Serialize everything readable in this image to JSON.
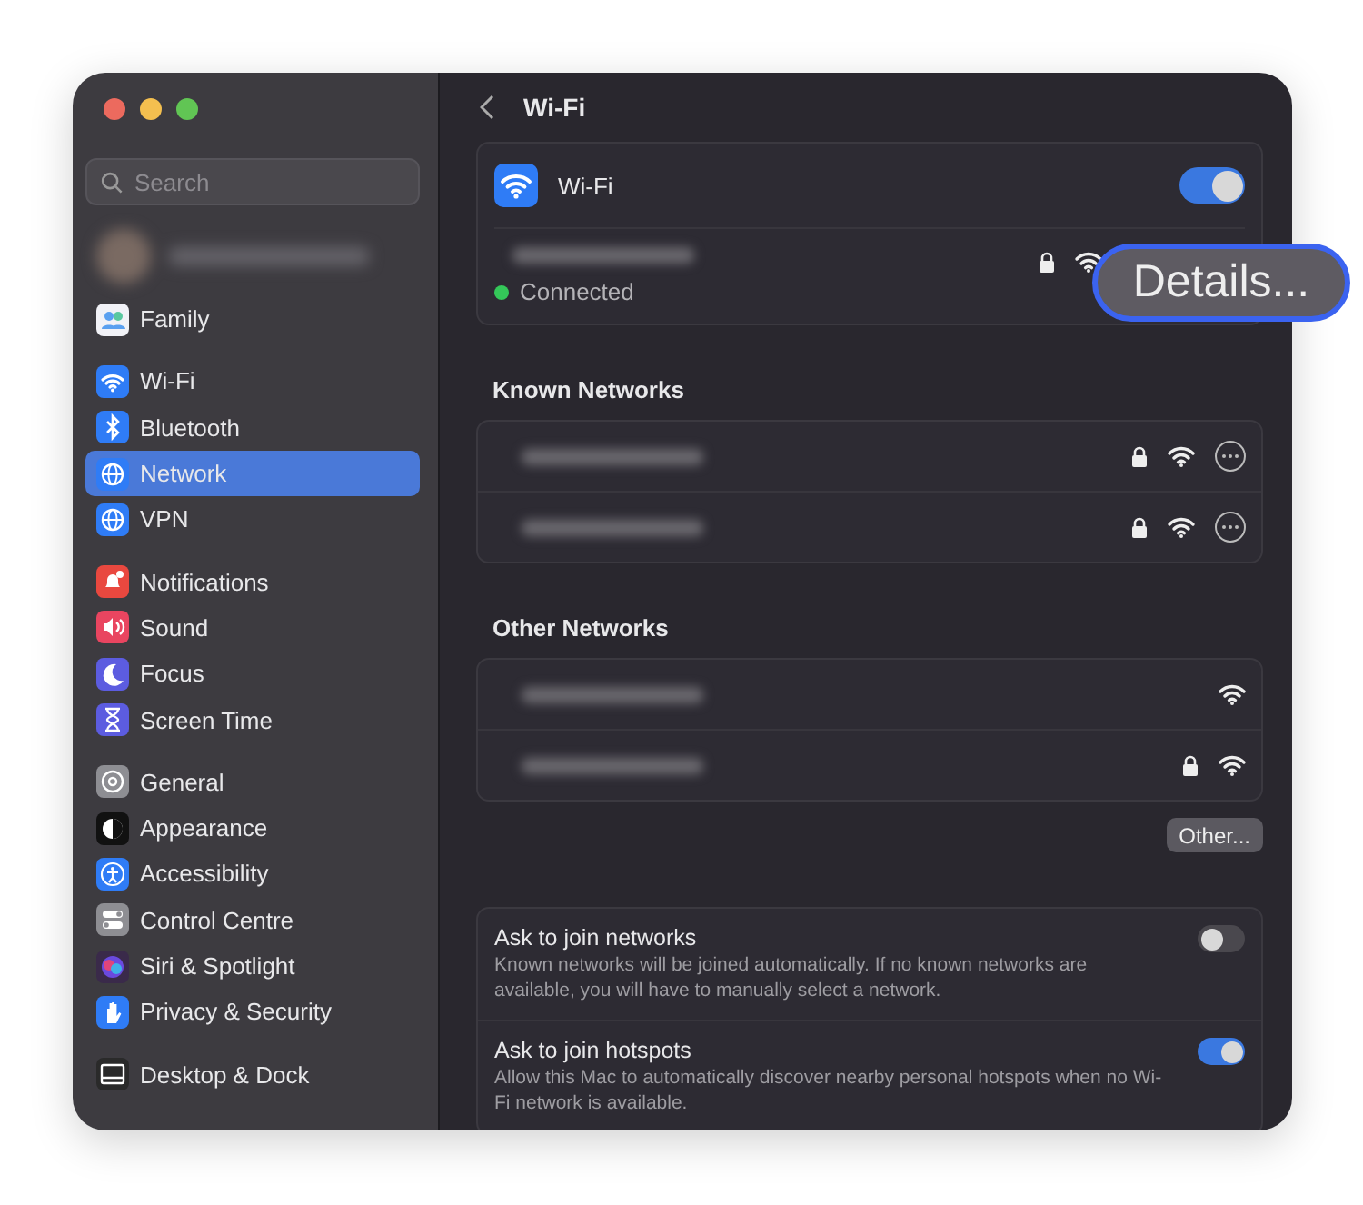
{
  "sidebar": {
    "search": {
      "placeholder": "Search"
    },
    "groups": [
      [
        {
          "label": "Family",
          "kind": "family",
          "color": "#f2f2f7",
          "selected": false
        }
      ],
      [
        {
          "label": "Wi-Fi",
          "kind": "wifi",
          "color": "#2f7cf6",
          "selected": false
        },
        {
          "label": "Bluetooth",
          "kind": "bluetooth",
          "color": "#2f7cf6",
          "selected": false
        },
        {
          "label": "Network",
          "kind": "globe",
          "color": "#2f7cf6",
          "selected": true
        },
        {
          "label": "VPN",
          "kind": "globe",
          "color": "#2f7cf6",
          "selected": false
        }
      ],
      [
        {
          "label": "Notifications",
          "kind": "bell",
          "color": "#e9483f",
          "selected": false
        },
        {
          "label": "Sound",
          "kind": "speaker",
          "color": "#e94560",
          "selected": false
        },
        {
          "label": "Focus",
          "kind": "moon",
          "color": "#5c5ce0",
          "selected": false
        },
        {
          "label": "Screen Time",
          "kind": "hourglass",
          "color": "#5c5ce0",
          "selected": false
        }
      ],
      [
        {
          "label": "General",
          "kind": "gear",
          "color": "#8e8e93",
          "selected": false
        },
        {
          "label": "Appearance",
          "kind": "contrast",
          "color": "#111111",
          "selected": false
        },
        {
          "label": "Accessibility",
          "kind": "person",
          "color": "#2f7cf6",
          "selected": false
        },
        {
          "label": "Control Centre",
          "kind": "toggles",
          "color": "#8e8e93",
          "selected": false
        },
        {
          "label": "Siri & Spotlight",
          "kind": "orb",
          "color": "#3a2a4a",
          "selected": false
        },
        {
          "label": "Privacy & Security",
          "kind": "hand",
          "color": "#2f7cf6",
          "selected": false
        }
      ],
      [
        {
          "label": "Desktop & Dock",
          "kind": "dock",
          "color": "#2a2a2a",
          "selected": false
        }
      ]
    ]
  },
  "header": {
    "title": "Wi-Fi"
  },
  "wifi": {
    "label": "Wi-Fi",
    "on": true,
    "current": {
      "status": "Connected",
      "locked": true
    }
  },
  "details_button": {
    "label": "Details..."
  },
  "known_networks": {
    "title": "Known Networks",
    "rows": [
      {
        "locked": true,
        "more": true
      },
      {
        "locked": true,
        "more": true
      }
    ]
  },
  "other_networks": {
    "title": "Other Networks",
    "rows": [
      {
        "locked": false,
        "more": false
      },
      {
        "locked": true,
        "more": false
      }
    ],
    "other_button": "Other..."
  },
  "settings": [
    {
      "title": "Ask to join networks",
      "description": "Known networks will be joined automatically. If no known networks are available, you will have to manually select a network.",
      "on": false
    },
    {
      "title": "Ask to join hotspots",
      "description": "Allow this Mac to automatically discover nearby personal hotspots when no Wi-Fi network is available.",
      "on": true
    }
  ]
}
